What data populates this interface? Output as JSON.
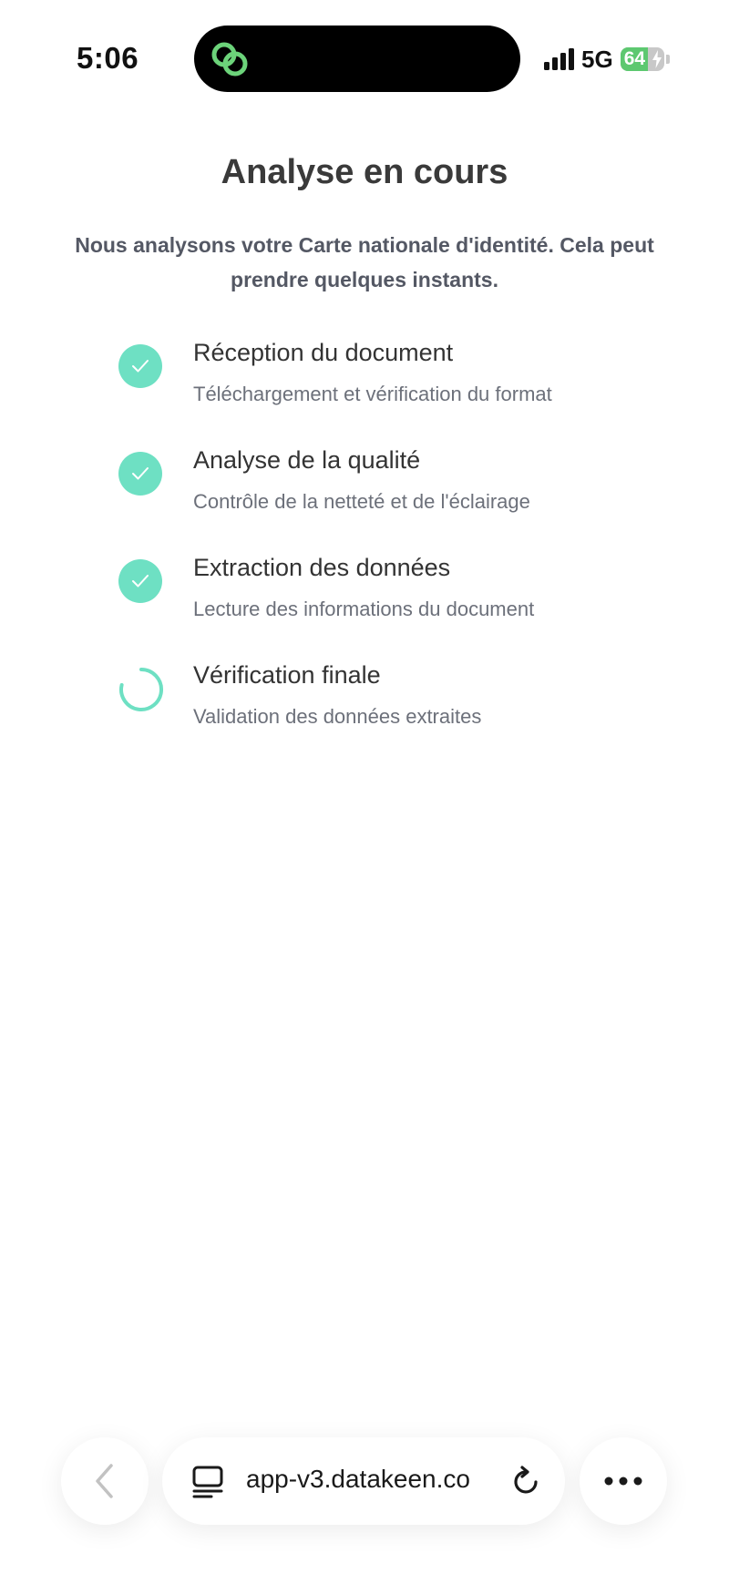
{
  "status_bar": {
    "time": "5:06",
    "network": "5G",
    "battery_level": "64",
    "battery_fraction": 0.64
  },
  "island": {
    "app_icon": "link-rings-icon"
  },
  "page": {
    "title": "Analyse en cours",
    "subtitle": "Nous analysons votre Carte nationale d'identité. Cela peut prendre quelques instants."
  },
  "steps": [
    {
      "title": "Réception du document",
      "description": "Téléchargement et vérification du format",
      "status": "done"
    },
    {
      "title": "Analyse de la qualité",
      "description": "Contrôle de la netteté et de l'éclairage",
      "status": "done"
    },
    {
      "title": "Extraction des données",
      "description": "Lecture des informations du document",
      "status": "done"
    },
    {
      "title": "Vérification finale",
      "description": "Validation des données extraites",
      "status": "in-progress"
    }
  ],
  "browser": {
    "url": "app-v3.datakeen.co",
    "icons": {
      "back": "chevron-left-icon",
      "tabs": "tabs-icon",
      "reload": "reload-icon",
      "more": "more-icon"
    }
  },
  "colors": {
    "accent": "#6ee0c3",
    "title": "#3a3a3a",
    "subtitle": "#545864",
    "step_desc": "#6c707a",
    "island_icon": "#6cd37a",
    "battery": "#5dc870"
  }
}
